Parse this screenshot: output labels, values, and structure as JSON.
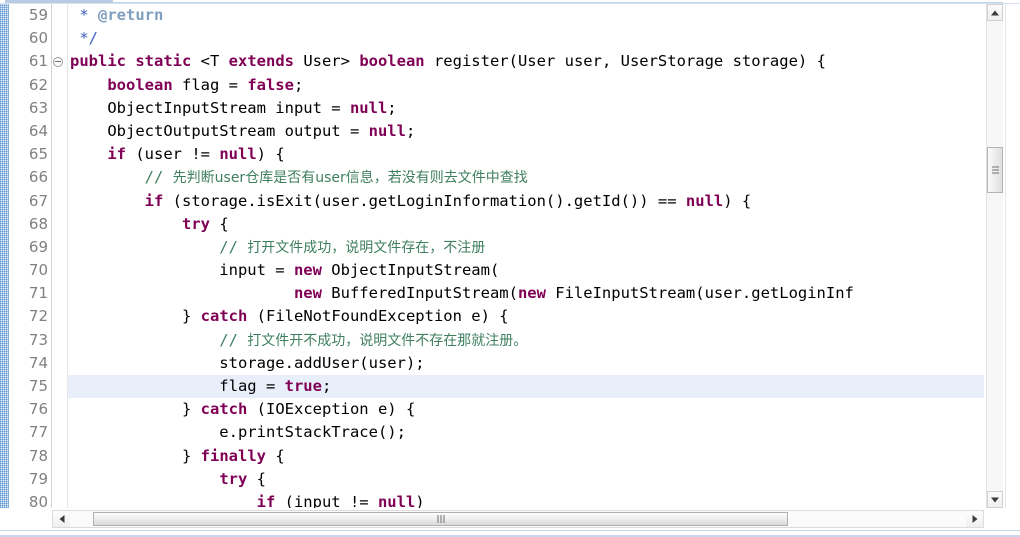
{
  "window": {
    "kind": "code-editor",
    "language": "Java"
  },
  "colors": {
    "keyword": "#7f0055",
    "comment": "#3f7f5f",
    "javadoc": "#3f5fbf",
    "javadoc_tag": "#7f9fbf",
    "plain_text": "#000000",
    "line_number": "#808080",
    "current_line_highlight": "#e8eefa",
    "annotation_ruler": "#a9c9e8",
    "background": "#ffffff"
  },
  "gutter": {
    "line_numbers": [
      "59",
      "60",
      "61",
      "62",
      "63",
      "64",
      "65",
      "66",
      "67",
      "68",
      "69",
      "70",
      "71",
      "72",
      "73",
      "74",
      "75",
      "76",
      "77",
      "78",
      "79",
      "80"
    ],
    "fold_marker_line": "61",
    "fold_marker_icon": "collapse-fold-icon"
  },
  "code": {
    "current_line_number": "75",
    "lines": [
      {
        "n": "59",
        "text": " * @return"
      },
      {
        "n": "60",
        "text": " */"
      },
      {
        "n": "61",
        "text": "public static <T extends User> boolean register(User user, UserStorage storage) {"
      },
      {
        "n": "62",
        "text": "    boolean flag = false;"
      },
      {
        "n": "63",
        "text": "    ObjectInputStream input = null;"
      },
      {
        "n": "64",
        "text": "    ObjectOutputStream output = null;"
      },
      {
        "n": "65",
        "text": "    if (user != null) {"
      },
      {
        "n": "66",
        "text": "        // 先判断user仓库是否有user信息，若没有则去文件中查找"
      },
      {
        "n": "67",
        "text": "        if (storage.isExit(user.getLoginInformation().getId()) == null) {"
      },
      {
        "n": "68",
        "text": "            try {"
      },
      {
        "n": "69",
        "text": "                // 打开文件成功，说明文件存在，不注册"
      },
      {
        "n": "70",
        "text": "                input = new ObjectInputStream("
      },
      {
        "n": "71",
        "text": "                        new BufferedInputStream(new FileInputStream(user.getLoginInf"
      },
      {
        "n": "72",
        "text": "            } catch (FileNotFoundException e) {"
      },
      {
        "n": "73",
        "text": "                // 打文件开不成功，说明文件不存在那就注册。"
      },
      {
        "n": "74",
        "text": "                storage.addUser(user);"
      },
      {
        "n": "75",
        "text": "                flag = true;"
      },
      {
        "n": "76",
        "text": "            } catch (IOException e) {"
      },
      {
        "n": "77",
        "text": "                e.printStackTrace();"
      },
      {
        "n": "78",
        "text": "            } finally {"
      },
      {
        "n": "79",
        "text": "                try {"
      },
      {
        "n": "80",
        "text": "                    if (input != null)"
      }
    ]
  },
  "scrollbars": {
    "vertical": {
      "up_arrow_icon": "arrow-up-icon",
      "down_arrow_icon": "arrow-down-icon",
      "thumb_grip_icon": "grip-dots-icon"
    },
    "horizontal": {
      "left_arrow_icon": "arrow-left-icon",
      "right_arrow_icon": "arrow-right-icon",
      "thumb_grip_icon": "grip-dots-icon"
    }
  }
}
